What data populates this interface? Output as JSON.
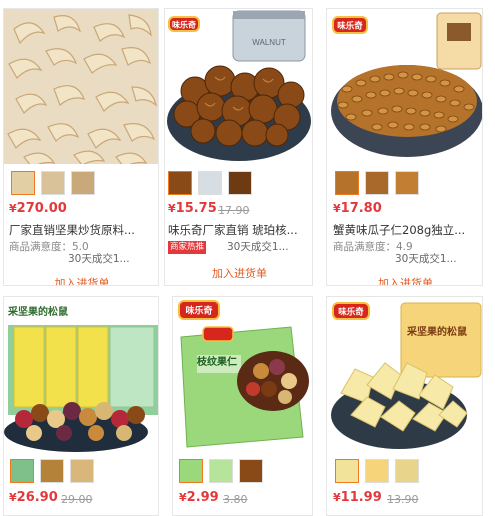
{
  "colors": {
    "price": "#e4393c",
    "add_link": "#e45a20",
    "border": "#e6e6e6",
    "selected_thumb": "#f07a1d"
  },
  "brand_logo_text": "味乐奇",
  "products": [
    {
      "price_symbol": "¥",
      "price": "270.00",
      "original_price": "",
      "title": "厂家直销坚果炒货原料...",
      "satisfaction": "商品满意度：5.0",
      "sold": "30天成交1...",
      "add_label": "加入进货单",
      "thumb_icons": [
        "cashew-thumb",
        "cashew-thumb",
        "cashew-thumb"
      ]
    },
    {
      "price_symbol": "¥",
      "price": "15.75",
      "original_price": "17.90",
      "title": "味乐奇厂家直销 琥珀核...",
      "badge": "商家热推",
      "sold": "30天成交1...",
      "add_label": "加入进货单",
      "thumb_icons": [
        "walnut-thumb",
        "jar-thumb",
        "walnut-thumb"
      ],
      "jar_label": "WALNUT"
    },
    {
      "price_symbol": "¥",
      "price": "17.80",
      "original_price": "",
      "title": "蟹黄味瓜子仁208g独立...",
      "satisfaction": "商品满意度：4.9",
      "sold": "30天成交1...",
      "add_label": "加入进货单",
      "thumb_icons": [
        "seed-thumb",
        "seed-thumb",
        "seed-thumb"
      ]
    },
    {
      "price_symbol": "¥",
      "price": "26.90",
      "original_price": "29.00",
      "thumb_icons": [
        "mixnut-thumb",
        "mixnut-thumb",
        "mixnut-thumb"
      ],
      "package_text": "采坚果的松鼠"
    },
    {
      "price_symbol": "¥",
      "price": "2.99",
      "original_price": "3.80",
      "thumb_icons": [
        "pack-thumb",
        "pack-thumb",
        "mixnut-thumb"
      ],
      "package_text": "枝纹果仁"
    },
    {
      "price_symbol": "¥",
      "price": "11.99",
      "original_price": "13.90",
      "thumb_icons": [
        "durian-thumb",
        "pack-thumb",
        "durian-thumb"
      ],
      "package_text": "采坚果的松鼠"
    }
  ]
}
